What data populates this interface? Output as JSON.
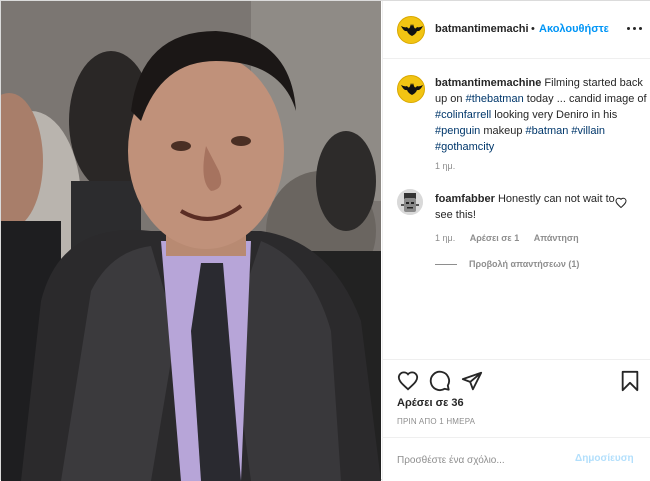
{
  "post": {
    "username": "batmantimemachi",
    "follow_label": "Ακολουθήστε",
    "separator": "•",
    "more_icon": "more-horizontal-icon"
  },
  "caption": {
    "username": "batmantimemachine",
    "text_1": " Filming started back up on ",
    "hashtag_1": "#thebatman",
    "text_2": " today ... candid image of ",
    "hashtag_2": "#colinfarrell",
    "text_3": " looking very Deniro in his ",
    "hashtag_3": "#penguin",
    "text_4": " makeup ",
    "hashtag_4": "#batman",
    "text_5": " ",
    "hashtag_5": "#villain",
    "text_6": " ",
    "hashtag_6": "#gothamcity",
    "time": "1 ημ."
  },
  "comment": {
    "username": "foamfabber",
    "text": " Honestly can not wait to see this!",
    "time": "1 ημ.",
    "likes_label": "Αρέσει σε 1",
    "reply_label": "Απάντηση",
    "view_replies": "Προβολή απαντήσεων (1)"
  },
  "actions": {
    "likes": "Αρέσει σε 36",
    "date": "ΠΡΙΝ ΑΠΟ 1 ΗΜΕΡΑ"
  },
  "comment_box": {
    "placeholder": "Προσθέστε ένα σχόλιο...",
    "publish_label": "Δημοσίευση"
  },
  "colors": {
    "accent": "#0095f6",
    "hashtag": "#00376b",
    "muted": "#8e8e8e",
    "avatar_yellow": "#f2c413"
  }
}
